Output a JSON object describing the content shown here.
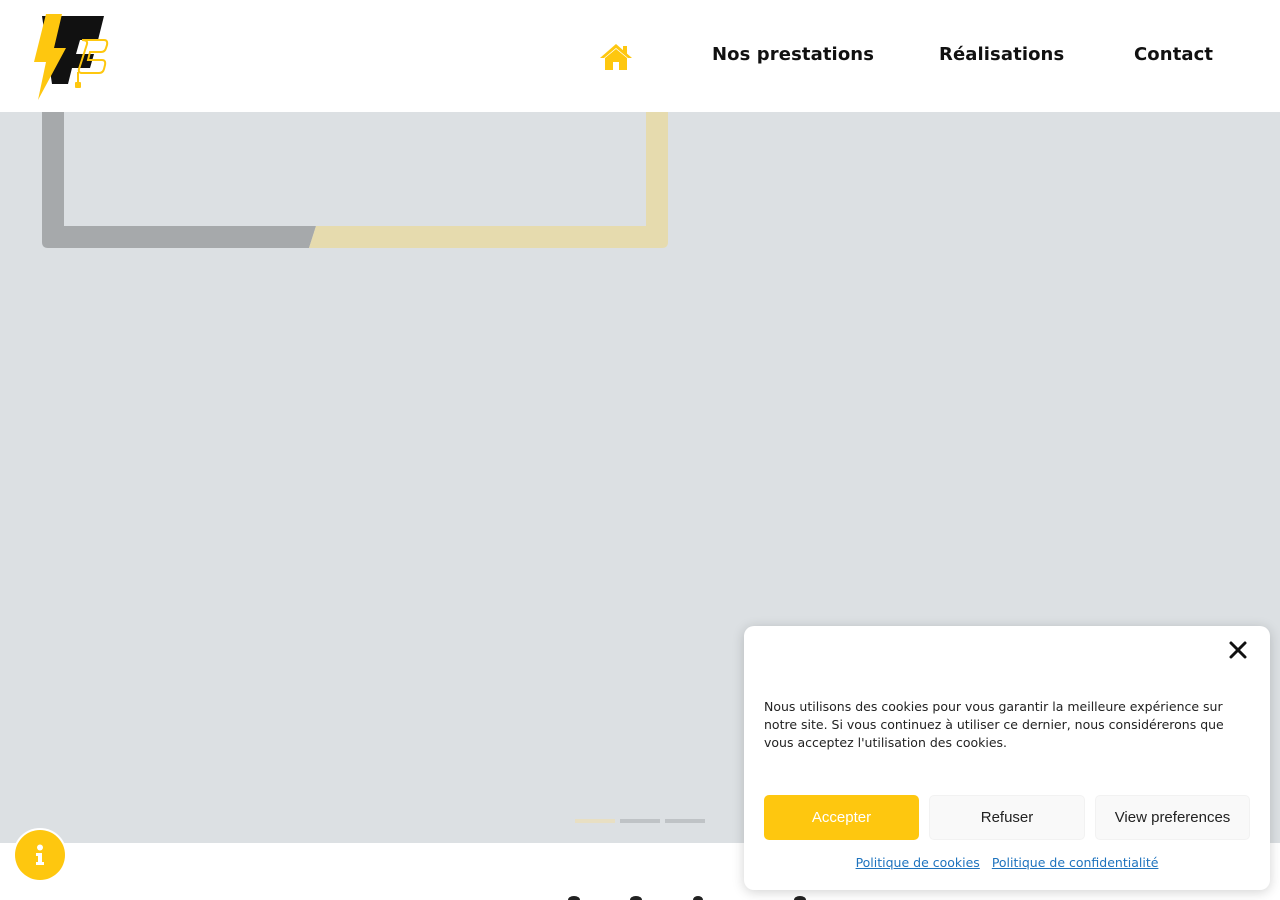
{
  "header": {
    "logo_alt": "FE",
    "nav": {
      "home_icon": "home-icon",
      "items": [
        {
          "label": "Nos prestations"
        },
        {
          "label": "Réalisations"
        },
        {
          "label": "Contact"
        }
      ]
    }
  },
  "hero": {
    "slider": {
      "slide_count": 3,
      "active_index": 0
    }
  },
  "info_badge": {
    "icon": "info-icon"
  },
  "cookie_banner": {
    "close_icon": "close-icon",
    "message": "Nous utilisons des cookies pour vous garantir la meilleure expérience sur notre site. Si vous continuez à utiliser ce dernier, nous considérerons que vous acceptez l'utilisation des cookies.",
    "buttons": {
      "accept": "Accepter",
      "refuse": "Refuser",
      "preferences": "View preferences"
    },
    "links": {
      "cookie_policy": "Politique de cookies",
      "privacy_policy": "Politique de confidentialité"
    }
  },
  "colors": {
    "accent_yellow": "#fec70f",
    "hero_background": "#dce0e3",
    "link_blue": "#1e73be",
    "text_dark": "#111111"
  }
}
